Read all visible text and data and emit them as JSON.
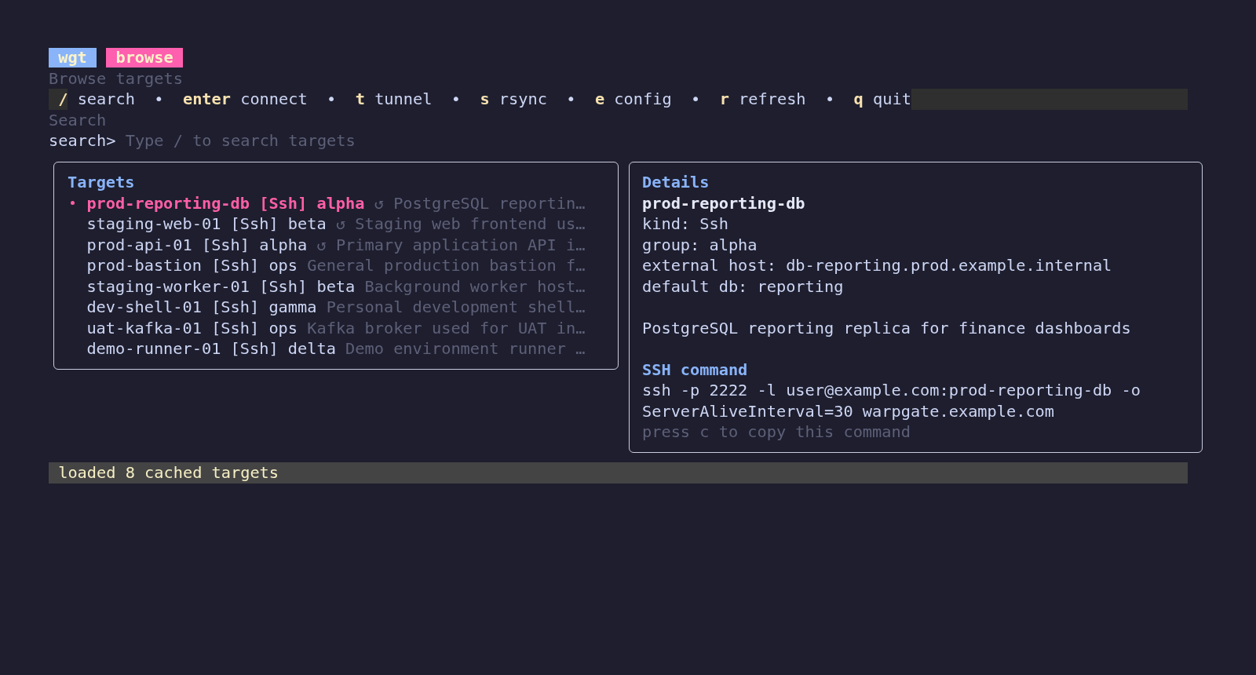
{
  "header": {
    "badges": [
      {
        "text": "wgt",
        "color": "#89b4fa"
      },
      {
        "text": "browse",
        "color": "#ff5faf"
      }
    ],
    "subtitle": "Browse targets"
  },
  "key_hints": [
    {
      "key": "/",
      "label": "search",
      "separator": "•"
    },
    {
      "key": "enter",
      "label": "connect",
      "separator": "•"
    },
    {
      "key": "t",
      "label": "tunnel",
      "separator": "•"
    },
    {
      "key": "s",
      "label": "rsync",
      "separator": "•"
    },
    {
      "key": "e",
      "label": "config",
      "separator": "•"
    },
    {
      "key": "r",
      "label": "refresh",
      "separator": "•"
    },
    {
      "key": "q",
      "label": "quit"
    }
  ],
  "search": {
    "label": "Search",
    "prompt": "search>",
    "placeholder": "Type / to search targets"
  },
  "targets": {
    "title": "Targets",
    "items": [
      {
        "name": "prod-reporting-db",
        "target_type": "[Ssh]",
        "group": "alpha",
        "marker": "↺",
        "description": "PostgreSQL reportin…",
        "selected": true
      },
      {
        "name": "staging-web-01",
        "target_type": "[Ssh]",
        "group": "beta",
        "marker": "↺",
        "description": "Staging web frontend us…",
        "selected": false
      },
      {
        "name": "prod-api-01",
        "target_type": "[Ssh]",
        "group": "alpha",
        "marker": "↺",
        "description": "Primary application API i…",
        "selected": false
      },
      {
        "name": "prod-bastion",
        "target_type": "[Ssh]",
        "group": "ops",
        "description": "General production bastion f…",
        "selected": false
      },
      {
        "name": "staging-worker-01",
        "target_type": "[Ssh]",
        "group": "beta",
        "description": "Background worker host…",
        "selected": false
      },
      {
        "name": "dev-shell-01",
        "target_type": "[Ssh]",
        "group": "gamma",
        "description": "Personal development shell…",
        "selected": false
      },
      {
        "name": "uat-kafka-01",
        "target_type": "[Ssh]",
        "group": "ops",
        "description": "Kafka broker used for UAT in…",
        "selected": false
      },
      {
        "name": "demo-runner-01",
        "target_type": "[Ssh]",
        "group": "delta",
        "description": "Demo environment runner …",
        "selected": false
      }
    ]
  },
  "details": {
    "title": "Details",
    "name": "prod-reporting-db",
    "fields": [
      "kind: Ssh",
      "group: alpha",
      "external host: db-reporting.prod.example.internal",
      "default db: reporting"
    ],
    "description": "PostgreSQL reporting replica for finance dashboards",
    "command": {
      "title": "SSH command",
      "lines": [
        "ssh -p 2222 -l user@example.com:prod-reporting-db -o",
        "ServerAliveInterval=30 warpgate.example.com"
      ],
      "hint": "press c to copy this command"
    }
  },
  "status_bar": "loaded 8 cached targets"
}
